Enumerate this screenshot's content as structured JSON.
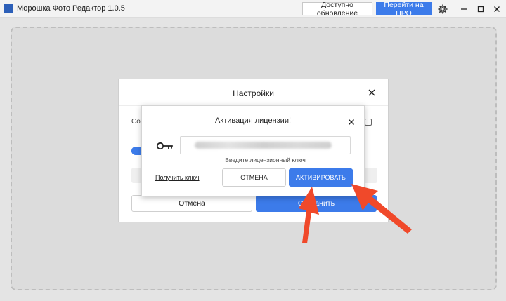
{
  "window": {
    "title": "Морошка Фото Редактор 1.0.5",
    "update_button": "Доступно обновление",
    "pro_button": "Перейти на ПРО"
  },
  "settings": {
    "title": "Настройки",
    "option_label": "Сох",
    "cancel_label": "Отмена",
    "save_label": "Сохранить"
  },
  "activation": {
    "title": "Активация лицензии!",
    "key_input_value": "",
    "hint": "Введите лицензионный ключ",
    "get_key_link": "Получить ключ",
    "cancel_label": "ОТМЕНА",
    "activate_label": "АКТИВИРОВАТЬ"
  },
  "icons": {
    "app": "app-logo-icon",
    "gear": "gear-icon",
    "minimize": "minimize-icon",
    "maximize": "maximize-icon",
    "close": "close-icon",
    "key": "key-icon"
  },
  "colors": {
    "accent": "#3c7bea",
    "annotation_arrow": "#f0492a"
  }
}
